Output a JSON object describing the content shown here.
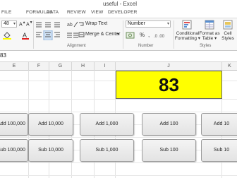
{
  "window": {
    "title": "useful - Excel"
  },
  "ribbon_tabs": [
    {
      "label": "FILE"
    },
    {
      "label": "FORMULAS"
    },
    {
      "label": "DATA"
    },
    {
      "label": "REVIEW"
    },
    {
      "label": "VIEW"
    },
    {
      "label": "DEVELOPER"
    }
  ],
  "font": {
    "size": "48"
  },
  "alignment": {
    "wrap_text": "Wrap Text",
    "merge_center": "Merge & Center",
    "group_label": "Alignment"
  },
  "number": {
    "format": "Number",
    "percent": "%",
    "comma": ",",
    "group_label": "Number"
  },
  "styles": {
    "conditional": "Conditional Formatting",
    "conditional_l1": "Conditional",
    "conditional_l2": "Formatting",
    "format_table_l1": "Format as",
    "format_table_l2": "Table",
    "cell_styles_l1": "Cell",
    "cell_styles_l2": "Styles",
    "group_label": "Styles"
  },
  "name_box": "83",
  "columns": [
    "E",
    "F",
    "G",
    "H",
    "I",
    "J",
    "K"
  ],
  "active_cell": {
    "value": "83",
    "fill": "#FFFF00"
  },
  "buttons_row1": [
    {
      "label": "Add 100,000"
    },
    {
      "label": "Add 10,000"
    },
    {
      "label": "Add 1,000"
    },
    {
      "label": "Add 100"
    },
    {
      "label": "Add 10"
    }
  ],
  "buttons_row2": [
    {
      "label": "Sub 100,000"
    },
    {
      "label": "Sub 10,000"
    },
    {
      "label": "Sub 1,000"
    },
    {
      "label": "Sub 100"
    },
    {
      "label": "Sub 10"
    }
  ],
  "colors": {
    "excel_green": "#217346",
    "cell_yellow": "#FFFF00",
    "font_red": "#E02020"
  }
}
